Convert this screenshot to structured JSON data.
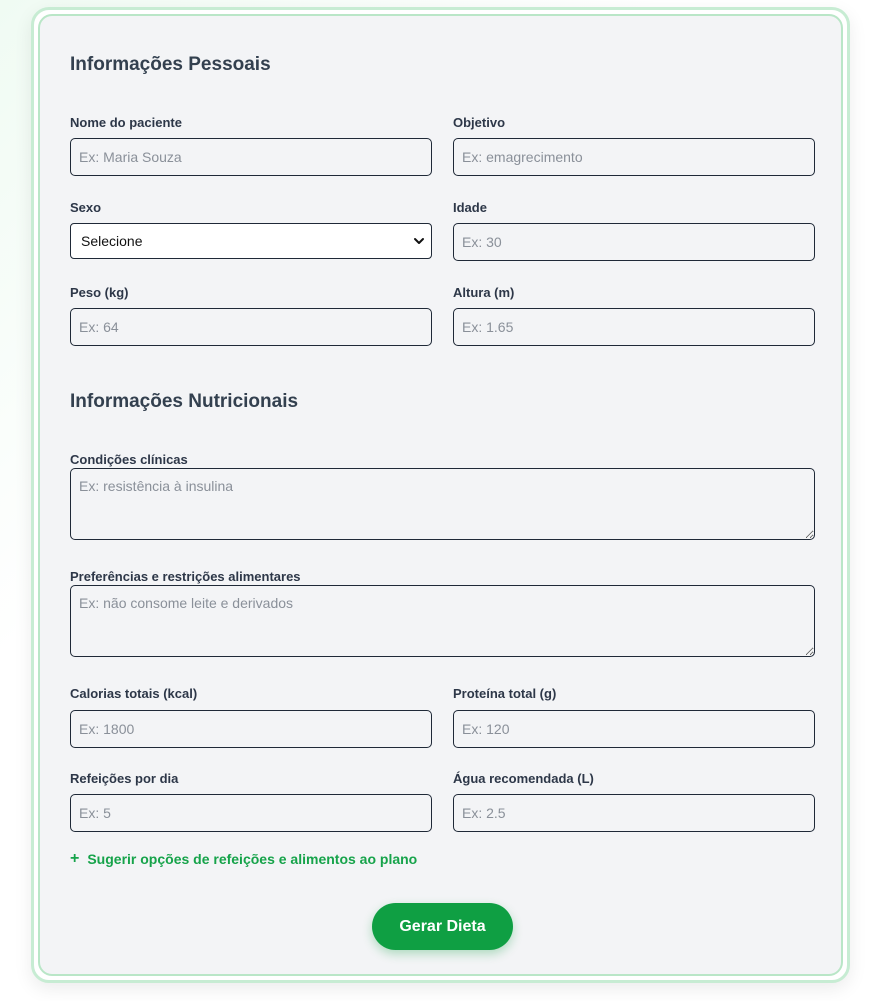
{
  "personal": {
    "title": "Informações Pessoais",
    "name_label": "Nome do paciente",
    "name_placeholder": "Ex: Maria Souza",
    "goal_label": "Objetivo",
    "goal_placeholder": "Ex: emagrecimento",
    "sex_label": "Sexo",
    "sex_selected": "Selecione",
    "age_label": "Idade",
    "age_placeholder": "Ex: 30",
    "weight_label": "Peso (kg)",
    "weight_placeholder": "Ex: 64",
    "height_label": "Altura (m)",
    "height_placeholder": "Ex: 1.65"
  },
  "nutrition": {
    "title": "Informações Nutricionais",
    "conditions_label": "Condições clínicas",
    "conditions_placeholder": "Ex: resistência à insulina",
    "preferences_label": "Preferências e restrições alimentares",
    "preferences_placeholder": "Ex: não consome leite e derivados",
    "calories_label": "Calorias totais (kcal)",
    "calories_placeholder": "Ex: 1800",
    "protein_label": "Proteína total (g)",
    "protein_placeholder": "Ex: 120",
    "meals_label": "Refeições por dia",
    "meals_placeholder": "Ex: 5",
    "water_label": "Água recomendada (L)",
    "water_placeholder": "Ex: 2.5"
  },
  "actions": {
    "suggest_icon": "+",
    "suggest_label": "Sugerir opções de refeições e alimentos ao plano",
    "generate_label": "Gerar Dieta"
  },
  "colors": {
    "accent": "#0f9f43",
    "card_border": "#b9e6c7",
    "card_background": "#f3f4f6"
  }
}
